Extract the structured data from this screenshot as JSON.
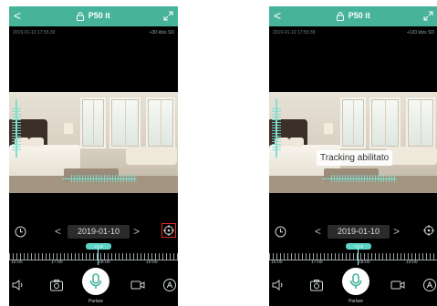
{
  "colors": {
    "accent": "#47b39b",
    "highlight": "#e0252b",
    "overlay": "#7be0d0"
  },
  "icons": {
    "back": "chevron-left-icon",
    "lock": "lock-icon",
    "expand": "expand-icon",
    "clock": "clock-icon",
    "target": "crosshair-target-icon",
    "speaker": "speaker-icon",
    "camera": "camera-icon",
    "mic": "microphone-icon",
    "video": "video-icon",
    "auto": "auto-icon"
  },
  "screens": [
    {
      "title": "P50 it",
      "back_label": "<",
      "info_left": "2019-01-10 17:55:39",
      "info_right": "+30 kb/s SD",
      "toast": "",
      "date": "2019-01-10",
      "prev_label": "<",
      "next_label": ">",
      "timeline_time": "17:45",
      "timeline_labels": [
        "16:00",
        "17:00",
        "18:00",
        "19:00"
      ],
      "talk_label": "Parlare"
    },
    {
      "title": "P50 it",
      "back_label": "<",
      "info_left": "2019-01-10 17:55:38",
      "info_right": "+120 kb/s SD",
      "toast": "Tracking abilitato",
      "date": "2019-01-10",
      "prev_label": "<",
      "next_label": ">",
      "timeline_time": "17:45",
      "timeline_labels": [
        "16:00",
        "17:00",
        "18:00",
        "19:00"
      ],
      "talk_label": "Parlare"
    }
  ]
}
